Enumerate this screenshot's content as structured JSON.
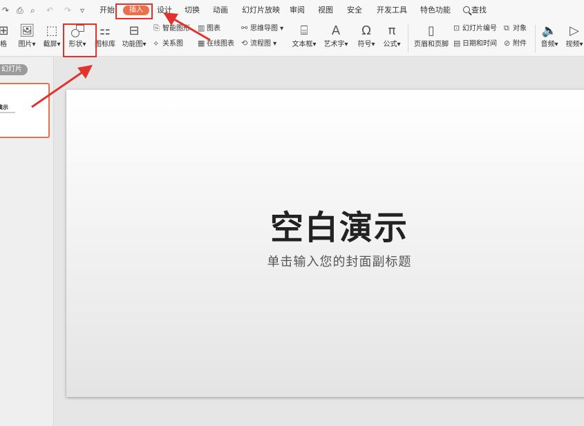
{
  "quick_access": {
    "redo": "↷",
    "print": "⎙",
    "preview": "⌕",
    "undo": "↶",
    "redo2": "↷",
    "more": "▿"
  },
  "menu": {
    "items": [
      "开始",
      "插入",
      "设计",
      "切换",
      "动画",
      "幻灯片放映",
      "审阅",
      "视图",
      "安全",
      "开发工具",
      "特色功能"
    ],
    "search": "查找",
    "active": "插入"
  },
  "ribbon": {
    "table": "格",
    "image": "图片",
    "screenshot": "截屏",
    "shapes": "形状",
    "icon_library": "图标库",
    "function_chart": "功能图",
    "smart_graphic": "智能图形",
    "relation_graph": "关系图",
    "chart": "图表",
    "online_chart": "在线图表",
    "mind_map": "思维导图",
    "flowchart": "流程图",
    "textbox": "文本框",
    "art_text": "艺术字",
    "symbol": "符号",
    "formula": "公式",
    "header_footer": "页眉和页脚",
    "slide_number": "幻灯片编号",
    "datetime": "日期和时间",
    "object": "对象",
    "attachment": "附件",
    "audio": "音频",
    "video": "视频"
  },
  "side_panel": {
    "tab": "幻灯片",
    "thumb_title": "演示"
  },
  "slide": {
    "title": "空白演示",
    "subtitle": "单击输入您的封面副标题"
  },
  "colors": {
    "accent": "#e8704a",
    "annotation": "#e0332b"
  }
}
